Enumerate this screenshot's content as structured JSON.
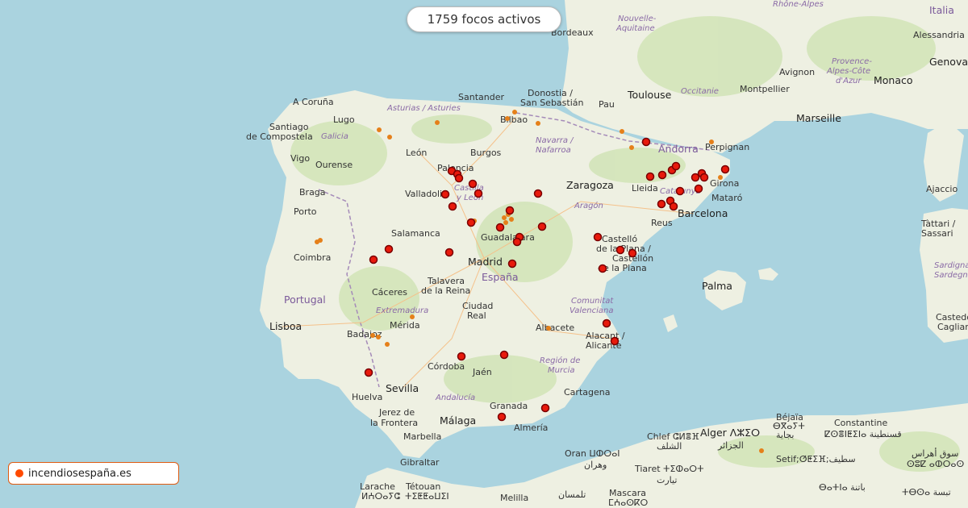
{
  "header": {
    "fire_count_text": "1759 focos activos"
  },
  "brand": {
    "label": "incendiosespaña.es",
    "dot_color": "#ff4a00"
  },
  "colors": {
    "fire_major": "#e81a0c",
    "fire_minor": "#e5801a",
    "sea": "#aad3df",
    "land": "#f2efe9"
  },
  "labels": {
    "coruna": "A Coruña",
    "santiago": "Santiago",
    "compostela": "de Compostela",
    "lugo": "Lugo",
    "galicia": "Galicia",
    "vigo": "Vigo",
    "ourense": "Ourense",
    "braga": "Braga",
    "porto": "Porto",
    "coimbra": "Coimbra",
    "portugal": "Portugal",
    "lisboa": "Lisboa",
    "badajoz": "Badajoz",
    "merida": "Mérida",
    "caceres": "Cáceres",
    "extremadura": "Extremadura",
    "asturias": "Asturias / Asturies",
    "santander": "Santander",
    "bilbao": "Bilbao",
    "donostia": "Donostia /",
    "sansebastian": "San Sebastián",
    "leon": "León",
    "burgos": "Burgos",
    "palencia": "Palencia",
    "valladolid": "Valladolid",
    "castilla": "Castilla",
    "yleon": "y León",
    "salamanca": "Salamanca",
    "navarra": "Navarra /",
    "nafarroa": "Nafarroa",
    "zaragoza": "Zaragoza",
    "aragon": "Aragón",
    "guadalajara": "Guadalajara",
    "madrid": "Madrid",
    "espana": "España",
    "talavera": "Talavera",
    "delareina": "de la Reina",
    "ciudadreal1": "Ciudad",
    "ciudadreal2": "Real",
    "cordoba": "Córdoba",
    "jaen": "Jaén",
    "sevilla": "Sevilla",
    "huelva": "Huelva",
    "jerez1": "Jerez de",
    "jerez2": "la Frontera",
    "andalucia": "Andalucía",
    "malaga": "Málaga",
    "marbella": "Marbella",
    "granada": "Granada",
    "almeria": "Almería",
    "gibraltar": "Gibraltar",
    "albacete": "Albacete",
    "murcia1": "Región de",
    "murcia2": "Murcia",
    "cartagena": "Cartagena",
    "alacant1": "Alacant /",
    "alacant2": "Alicante",
    "comunitat1": "Comunitat",
    "comunitat2": "Valenciana",
    "castello1": "Castelló",
    "castello2": "de la Plana /",
    "castello3": "Castellón",
    "castello4": "de la Plana",
    "lleida": "Lleida",
    "catalunya": "Catalunya",
    "barcelona": "Barcelona",
    "reus": "Reus",
    "girona": "Girona",
    "mataro": "Mataró",
    "andorra": "Andorra",
    "perpignan": "Perpignan",
    "bordeaux": "Bordeaux",
    "nouvelle": "Nouvelle-",
    "aquitaine": "Aquitaine",
    "toulouse": "Toulouse",
    "occitanie": "Occitanie",
    "montpellier": "Montpellier",
    "marseille": "Marseille",
    "avignon": "Avignon",
    "pau": "Pau",
    "provence1": "Provence-",
    "provence2": "Alpes-Côte",
    "provence3": "d'Azur",
    "monaco": "Monaco",
    "genova": "Genova",
    "alessandria": "Alessandria",
    "rhone": "Rhône-Alpes",
    "italia": "Italia",
    "palma": "Palma",
    "ajaccio": "Ajaccio",
    "tattari": "Tàttari /",
    "sassari": "Sassari",
    "sardigna": "Sardigna /",
    "sardegna": "Sardegna",
    "casteddu": "Casteddu",
    "cagliari": "Cagliari",
    "oran1": "Oran ⵡⵀⵔⴰⵏ",
    "oran2": "وهران",
    "chlef1": "Chlef ⵛⵍⴻⴼ",
    "chlef2": "الشلف",
    "alger1": "Alger ⴷⵣⵉⵔ",
    "alger2": "الجزائر",
    "bejaia1": "Béjaïa",
    "bejaia2": "ⴱⴳⴰⵢⵜ",
    "bejaia3": "بجاية",
    "constantine1": "Constantine",
    "constantine2": "ⵇⵙⴻⵏⵟⵉⵏⴰ قسنطينة",
    "tiaret1": "Tiaret ⵜⵉⵀⴰⵔⵜ",
    "tiaret2": "تيارت",
    "setif": "Setif;ⵚⵟⵉⴼ;سطيف",
    "larache1": "Larache",
    "larache2": "ⵍⵄⵔⴰⵢⵛ",
    "tetouan1": "Tétouan",
    "tetouan2": "ⵜⵉⵟⵟⴰⵡⵉⵏ",
    "melilla": "Melilla",
    "tlemcen": "تلمسان",
    "mascara1": "Mascara",
    "mascara2": "ⵎⵄⴰⵙⴽⵔ",
    "batna": "ⴱⴰⵜⵏⴰ باتنة",
    "tebessa": "ⵜⴱⵙⴰ تبسة",
    "souk1": "سوق أهراس",
    "souk2": "ⵙⵓⵇ ⴰⵀⵔⴰⵙ"
  }
}
